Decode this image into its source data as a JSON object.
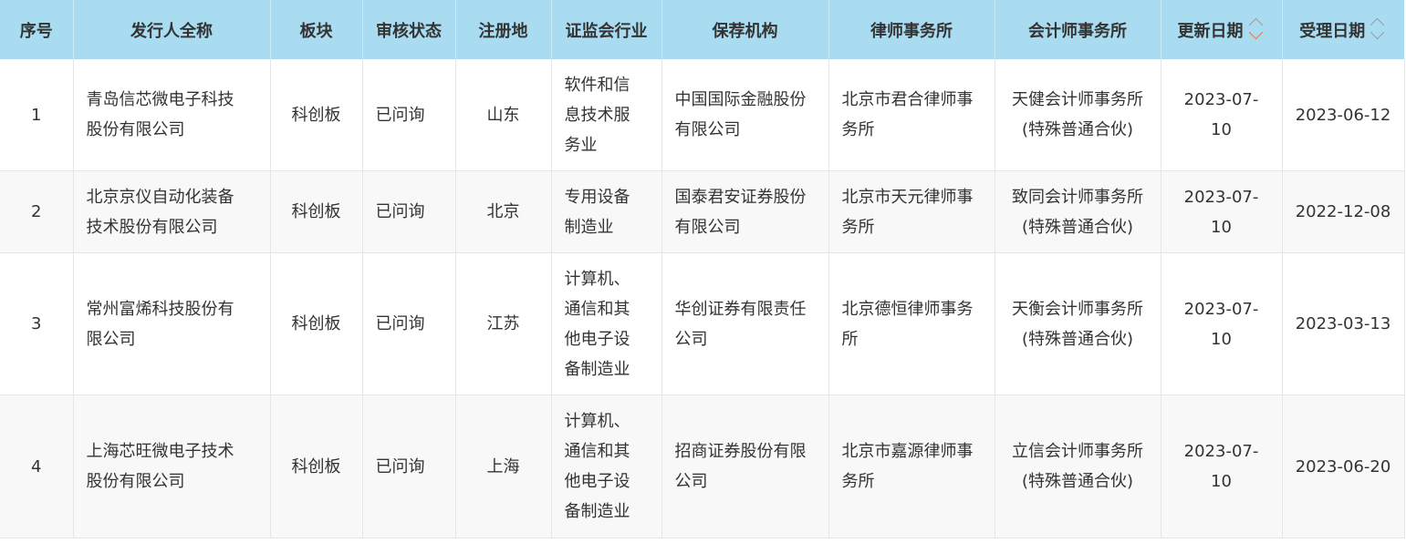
{
  "headers": {
    "index": "序号",
    "issuer": "发行人全称",
    "board": "板块",
    "status": "审核状态",
    "location": "注册地",
    "industry": "证监会行业",
    "sponsor": "保荐机构",
    "law_firm": "律师事务所",
    "accounting_firm": "会计师事务所",
    "update_date": "更新日期",
    "accept_date": "受理日期"
  },
  "sort": {
    "update_date": {
      "up_icon": "chevron-up-icon",
      "down_icon": "chevron-down-icon",
      "active": "down",
      "active_color": "#e8754a"
    },
    "accept_date": {
      "up_icon": "chevron-up-icon",
      "down_icon": "chevron-down-icon",
      "active": "none"
    }
  },
  "colors": {
    "header_bg": "#a9dcf0",
    "stripe_bg": "#f8f8f8",
    "text": "#333333"
  },
  "rows": [
    {
      "index": "1",
      "issuer": [
        "青岛信芯微电子科技",
        "股份有限公司"
      ],
      "board": "科创板",
      "status": "已问询",
      "location": "山东",
      "industry": [
        "软件和信",
        "息技术服",
        "务业"
      ],
      "sponsor": [
        "中国国际金融股份",
        "有限公司"
      ],
      "law_firm": [
        "北京市君合律师事",
        "务所"
      ],
      "accounting_firm": [
        "天健会计师事务所",
        "(特殊普通合伙)"
      ],
      "update_date": "2023-07-10",
      "accept_date": "2023-06-12"
    },
    {
      "index": "2",
      "issuer": [
        "北京京仪自动化装备",
        "技术股份有限公司"
      ],
      "board": "科创板",
      "status": "已问询",
      "location": "北京",
      "industry": [
        "专用设备",
        "制造业"
      ],
      "sponsor": [
        "国泰君安证券股份",
        "有限公司"
      ],
      "law_firm": [
        "北京市天元律师事",
        "务所"
      ],
      "accounting_firm": [
        "致同会计师事务所",
        "(特殊普通合伙)"
      ],
      "update_date": "2023-07-10",
      "accept_date": "2022-12-08"
    },
    {
      "index": "3",
      "issuer": [
        "常州富烯科技股份有",
        "限公司"
      ],
      "board": "科创板",
      "status": "已问询",
      "location": "江苏",
      "industry": [
        "计算机、",
        "通信和其",
        "他电子设",
        "备制造业"
      ],
      "sponsor": [
        "华创证券有限责任",
        "公司"
      ],
      "law_firm": [
        "北京德恒律师事务",
        "所"
      ],
      "accounting_firm": [
        "天衡会计师事务所",
        "(特殊普通合伙)"
      ],
      "update_date": "2023-07-10",
      "accept_date": "2023-03-13"
    },
    {
      "index": "4",
      "issuer": [
        "上海芯旺微电子技术",
        "股份有限公司"
      ],
      "board": "科创板",
      "status": "已问询",
      "location": "上海",
      "industry": [
        "计算机、",
        "通信和其",
        "他电子设",
        "备制造业"
      ],
      "sponsor": [
        "招商证券股份有限",
        "公司"
      ],
      "law_firm": [
        "北京市嘉源律师事",
        "务所"
      ],
      "accounting_firm": [
        "立信会计师事务所",
        "(特殊普通合伙)"
      ],
      "update_date": "2023-07-10",
      "accept_date": "2023-06-20"
    }
  ]
}
